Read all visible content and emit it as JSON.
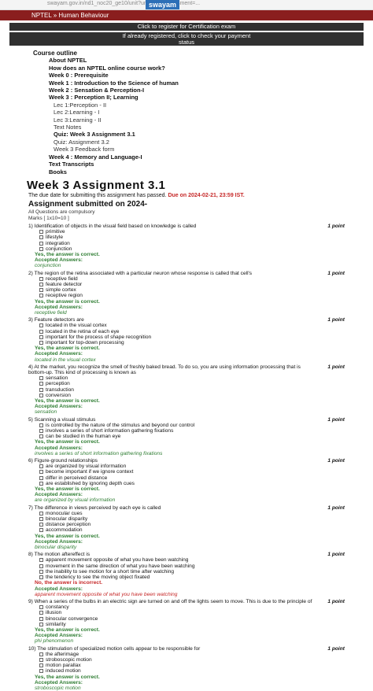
{
  "browser": {
    "url": "swayam.gov.in/nd1_noc20_ge10/unit?unit=28&assessment=...",
    "logo": "swayam"
  },
  "nav": {
    "title": "NPTEL » Human Behaviour"
  },
  "buttons": {
    "register": "Click to register for Certification exam",
    "registered_line1": "If already registered, click to check your payment",
    "registered_line2": "status"
  },
  "outline": {
    "heading": "Course outline",
    "items": [
      {
        "label": "About NPTEL",
        "type": "item"
      },
      {
        "label": "How does an NPTEL online course work?",
        "type": "item"
      },
      {
        "label": "Week 0 : Prerequisite",
        "type": "item"
      },
      {
        "label": "Week 1 : Introduction to the Science of human",
        "type": "item"
      },
      {
        "label": "Week 2 : Sensation & Perception-I",
        "type": "item"
      },
      {
        "label": "Week 3 : Perception II; Learning",
        "type": "item"
      },
      {
        "label": "Lec 1:Perception - II",
        "type": "sub"
      },
      {
        "label": "Lec 2:Learning - I",
        "type": "sub"
      },
      {
        "label": "Lec 3:Learning - II",
        "type": "sub"
      },
      {
        "label": "Text Notes",
        "type": "sub"
      },
      {
        "label": "Quiz: Week 3 Assignment 3.1",
        "type": "sub-active"
      },
      {
        "label": "Quiz: Assignment 3.2",
        "type": "sub"
      },
      {
        "label": "Week 3 Feedback form",
        "type": "sub"
      },
      {
        "label": "Week 4 : Memory and Language-I",
        "type": "item"
      },
      {
        "label": "Text Transcripts",
        "type": "item"
      },
      {
        "label": "Books",
        "type": "item"
      }
    ]
  },
  "assignment": {
    "title": "Week 3 Assignment 3.1",
    "due_text": "The due date for submitting this assignment has passed.",
    "due_date": "Due on 2024-02-21, 23:59 IST.",
    "submitted": "Assignment submitted on 2024-",
    "meta1": "All Questions are compulsory",
    "meta2": "Marks [ 1x10=10 ]"
  },
  "questions": [
    {
      "text": "1) Identification of objects in the visual field based on knowledge is called",
      "points": "1 point",
      "options": [
        "primitive",
        "lifestyle",
        "integration",
        "conjunction"
      ],
      "result": "Yes, the answer is correct.",
      "result_type": "ok",
      "accepted_label": "Accepted Answers:",
      "accepted": "conjunction"
    },
    {
      "text": "2) The region of the retina associated with a particular neuron whose response is called that cell's",
      "points": "1 point",
      "options": [
        "receptive field",
        "feature detector",
        "simple cortex",
        "receptive region"
      ],
      "result": "Yes, the answer is correct.",
      "result_type": "ok",
      "accepted_label": "Accepted Answers:",
      "accepted": "receptive field"
    },
    {
      "text": "3) Feature detectors are",
      "points": "1 point",
      "options": [
        "located in the visual cortex",
        "located in the retina of each eye",
        "important for the process of shape recognition",
        "important for top-down processing"
      ],
      "result": "Yes, the answer is correct.",
      "result_type": "ok",
      "accepted_label": "Accepted Answers:",
      "accepted": "located in the visual cortex"
    },
    {
      "text": "4) At the market, you recognize the smell of freshly baked bread. To do so, you are using information processing that is bottom-up. This kind of processing is known as",
      "points": "1 point",
      "options": [
        "sensation",
        "perception",
        "transduction",
        "conversion"
      ],
      "result": "Yes, the answer is correct.",
      "result_type": "ok",
      "accepted_label": "Accepted Answers:",
      "accepted": "sensation"
    },
    {
      "text": "5) Scanning a visual stimulus",
      "points": "1 point",
      "options": [
        "is controlled by the nature of the stimulus and beyond our control",
        "involves a series of short information gathering fixations",
        "can be studied in the human eye"
      ],
      "result": "Yes, the answer is correct.",
      "result_type": "ok",
      "accepted_label": "Accepted Answers:",
      "accepted": "involves a series of short information gathering fixations"
    },
    {
      "text": "6) Figure-ground relationships",
      "points": "1 point",
      "options": [
        "are organized by visual information",
        "become important if we ignore context",
        "differ in perceived distance",
        "are established by ignoring depth cues"
      ],
      "result": "Yes, the answer is correct.",
      "result_type": "ok",
      "accepted_label": "Accepted Answers:",
      "accepted": "are organized by visual information"
    },
    {
      "text": "7) The difference in views perceived by each eye is called",
      "points": "1 point",
      "options": [
        "monocular cues",
        "binocular disparity",
        "distance perception",
        "accommodation"
      ],
      "result": "Yes, the answer is correct.",
      "result_type": "ok",
      "accepted_label": "Accepted Answers:",
      "accepted": "binocular disparity"
    },
    {
      "text": "8) The motion aftereffect is",
      "points": "1 point",
      "options": [
        "apparent movement opposite of what you have been watching",
        "movement in the same direction of what you have been watching",
        "the inability to see motion for a short time after watching",
        "the tendency to see the moving object fixated"
      ],
      "result": "No, the answer is incorrect.",
      "result_type": "bad",
      "accepted_label": "Accepted Answers:",
      "accepted": "apparent movement opposite of what you have been watching"
    },
    {
      "text": "9) When a series of the bulbs in an electric sign are turned on and off the lights seem to move. This is due to the principle of",
      "points": "1 point",
      "options": [
        "constancy",
        "illusion",
        "binocular convergence",
        "similarity"
      ],
      "result": "Yes, the answer is correct.",
      "result_type": "ok",
      "accepted_label": "Accepted Answers:",
      "accepted": "phi phenomenon"
    },
    {
      "text": "10) The stimulation of specialized motion cells appear to be responsible for",
      "points": "1 point",
      "options": [
        "the afterimage",
        "stroboscopic motion",
        "motion parallax",
        "induced motion"
      ],
      "result": "Yes, the answer is correct.",
      "result_type": "ok",
      "accepted_label": "Accepted Answers:",
      "accepted": "stroboscopic motion"
    }
  ]
}
